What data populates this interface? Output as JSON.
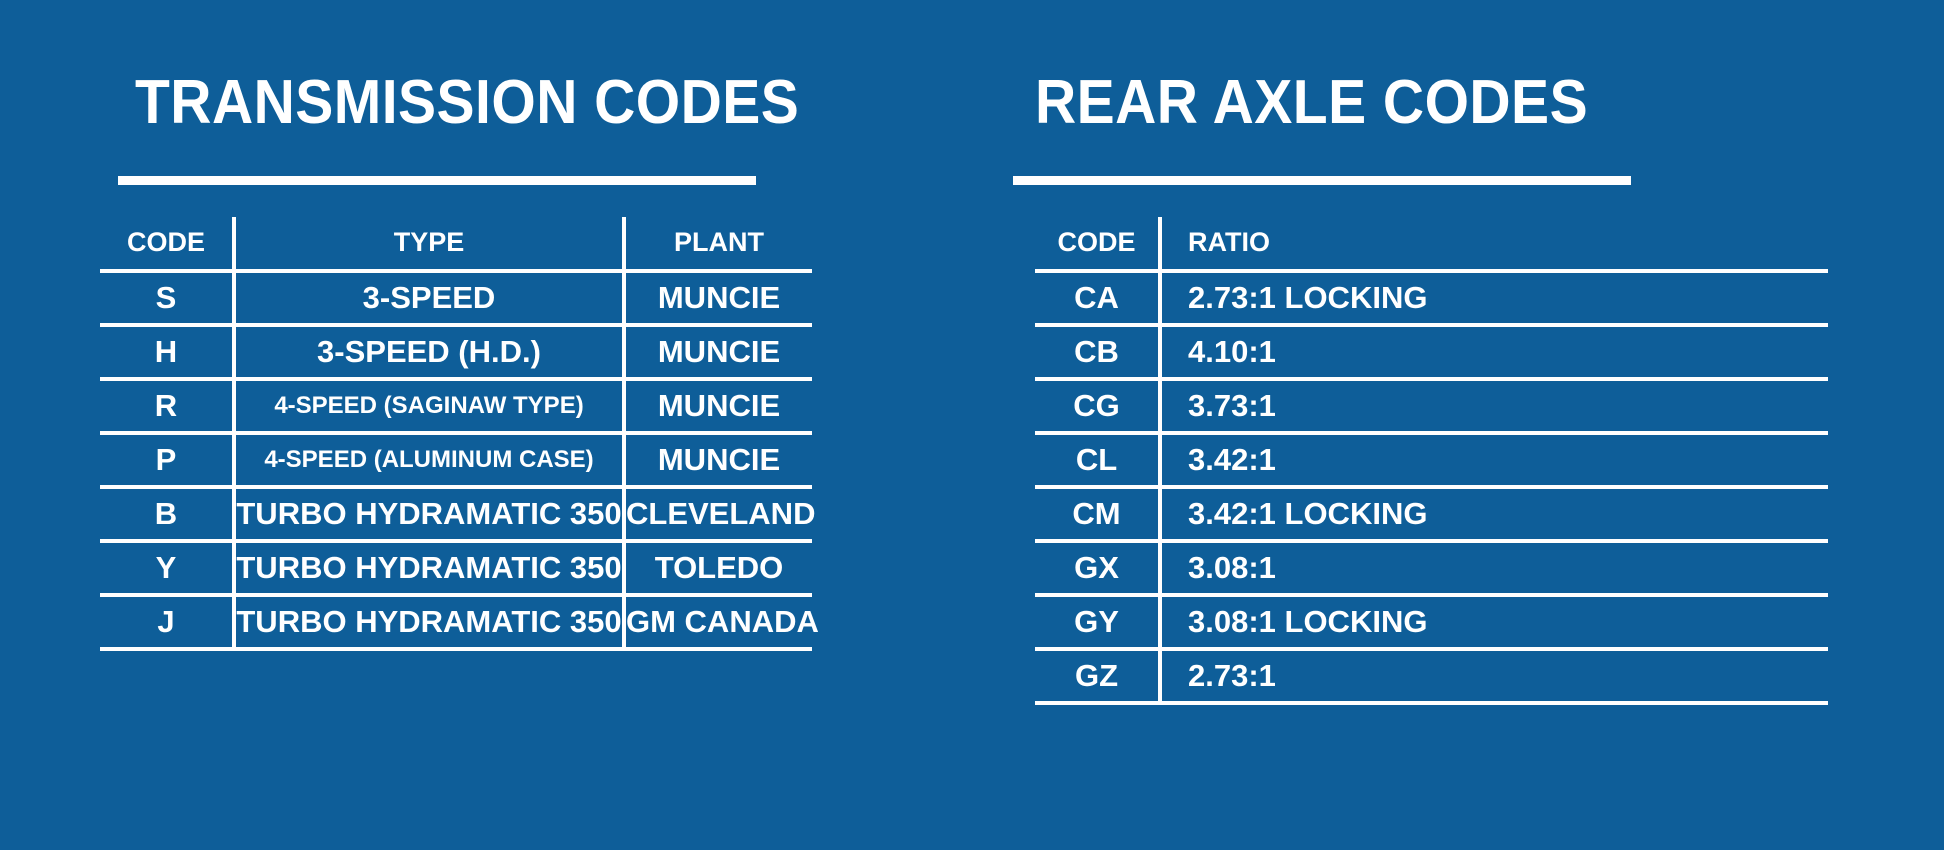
{
  "background_color": "#0e5e99",
  "text_color": "#ffffff",
  "transmission": {
    "title": "TRANSMISSION CODES",
    "columns": [
      "CODE",
      "TYPE",
      "PLANT"
    ],
    "rows": [
      {
        "code": "S",
        "type": "3-SPEED",
        "plant": "MUNCIE",
        "small": false
      },
      {
        "code": "H",
        "type": "3-SPEED (H.D.)",
        "plant": "MUNCIE",
        "small": false
      },
      {
        "code": "R",
        "type": "4-SPEED (SAGINAW TYPE)",
        "plant": "MUNCIE",
        "small": true
      },
      {
        "code": "P",
        "type": "4-SPEED (ALUMINUM CASE)",
        "plant": "MUNCIE",
        "small": true
      },
      {
        "code": "B",
        "type": "TURBO HYDRAMATIC 350",
        "plant": "CLEVELAND",
        "small": false
      },
      {
        "code": "Y",
        "type": "TURBO HYDRAMATIC 350",
        "plant": "TOLEDO",
        "small": false
      },
      {
        "code": "J",
        "type": "TURBO HYDRAMATIC 350",
        "plant": "GM CANADA",
        "small": false
      }
    ]
  },
  "rear_axle": {
    "title": "REAR AXLE CODES",
    "columns": [
      "CODE",
      "RATIO"
    ],
    "rows": [
      {
        "code": "CA",
        "ratio": "2.73:1 LOCKING"
      },
      {
        "code": "CB",
        "ratio": "4.10:1"
      },
      {
        "code": "CG",
        "ratio": "3.73:1"
      },
      {
        "code": "CL",
        "ratio": "3.42:1"
      },
      {
        "code": "CM",
        "ratio": "3.42:1 LOCKING"
      },
      {
        "code": "GX",
        "ratio": "3.08:1"
      },
      {
        "code": "GY",
        "ratio": "3.08:1 LOCKING"
      },
      {
        "code": "GZ",
        "ratio": "2.73:1"
      }
    ]
  }
}
